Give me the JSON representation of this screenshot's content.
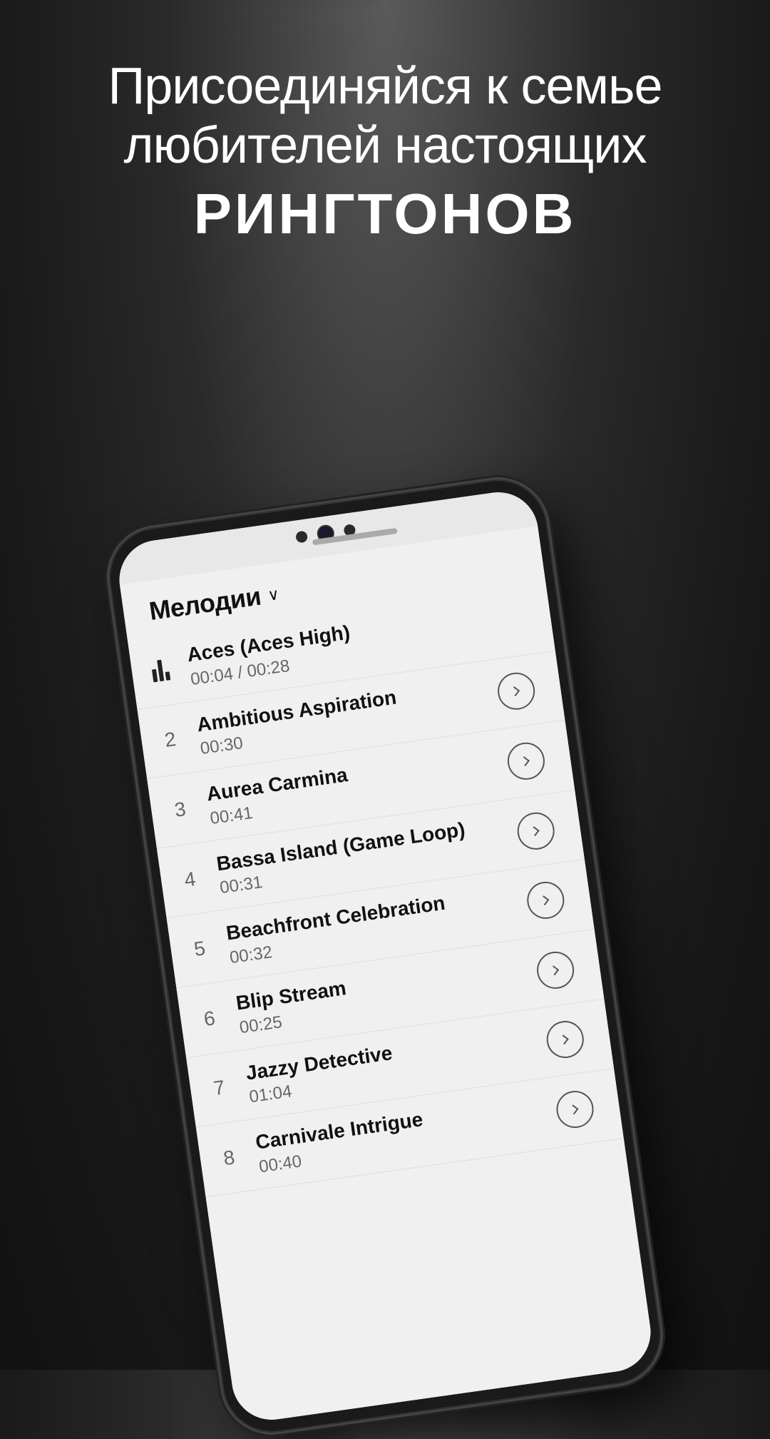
{
  "promo": {
    "line1": "Присоединяйся к семье любителей настоящих",
    "line_bold": "РИНГТОНОВ"
  },
  "app": {
    "header_title": "Мелодии",
    "chevron": "∨"
  },
  "tracks": [
    {
      "number": "",
      "name": "Aces (Aces High)",
      "duration": "00:04 / 00:28",
      "is_playing": true,
      "has_button": false
    },
    {
      "number": "2",
      "name": "Ambitious Aspiration",
      "duration": "00:30",
      "is_playing": false,
      "has_button": true
    },
    {
      "number": "3",
      "name": "Aurea Carmina",
      "duration": "00:41",
      "is_playing": false,
      "has_button": true
    },
    {
      "number": "4",
      "name": "Bassa Island (Game Loop)",
      "duration": "00:31",
      "is_playing": false,
      "has_button": true
    },
    {
      "number": "5",
      "name": "Beachfront Celebration",
      "duration": "00:32",
      "is_playing": false,
      "has_button": true
    },
    {
      "number": "6",
      "name": "Blip Stream",
      "duration": "00:25",
      "is_playing": false,
      "has_button": true
    },
    {
      "number": "7",
      "name": "Jazzy Detective",
      "duration": "01:04",
      "is_playing": false,
      "has_button": true
    },
    {
      "number": "8",
      "name": "Carnivale Intrigue",
      "duration": "00:40",
      "is_playing": false,
      "has_button": true
    }
  ]
}
